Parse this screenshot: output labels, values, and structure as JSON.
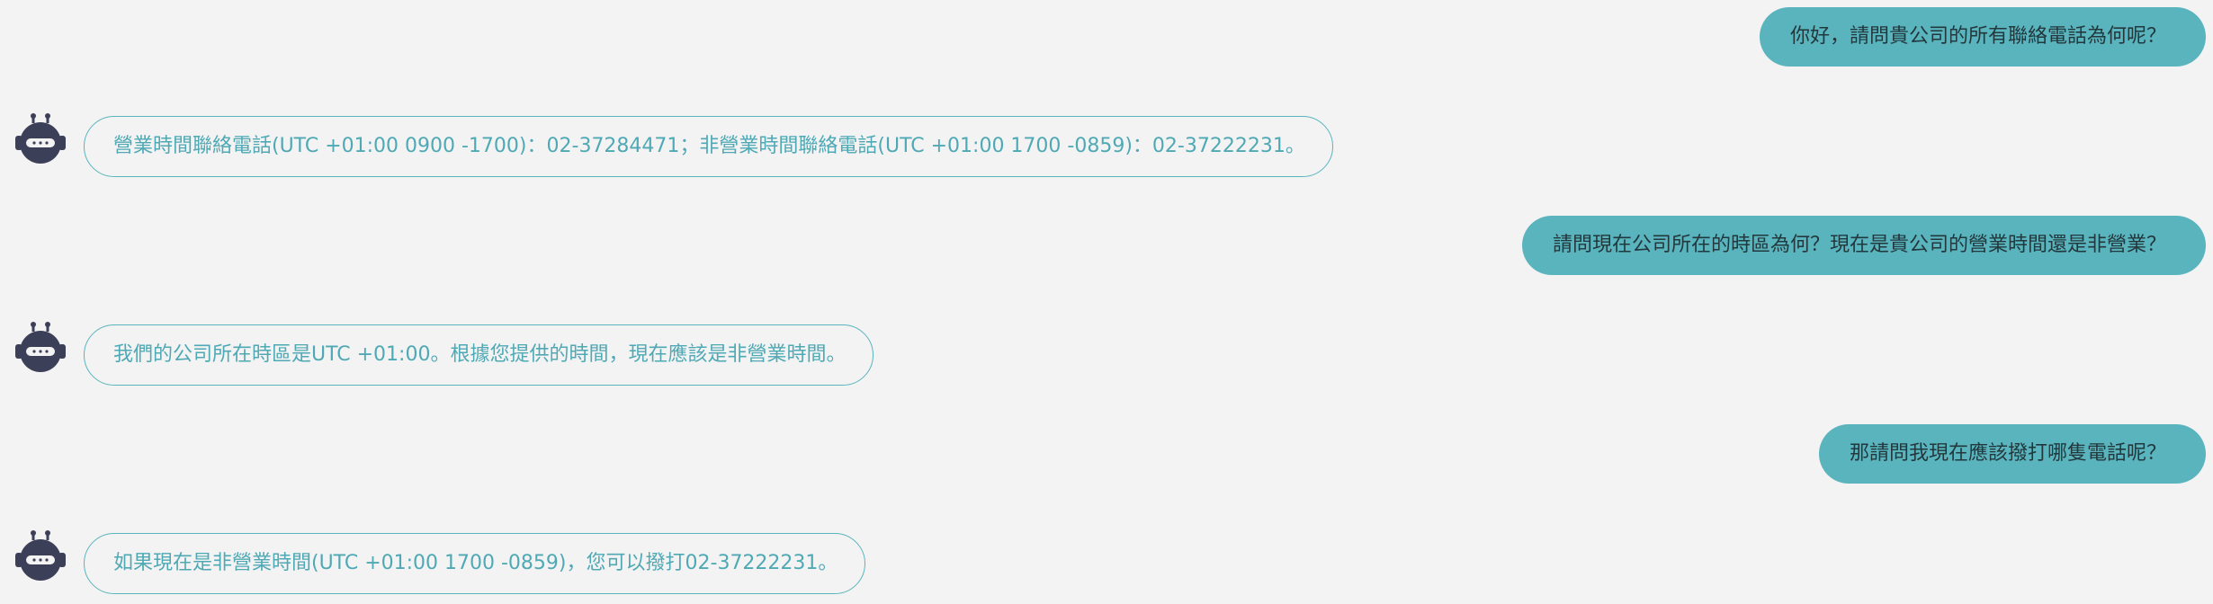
{
  "colors": {
    "page_background": "#f3f3f3",
    "user_bubble": "#5ab4be",
    "user_text": "#23383c",
    "bot_border": "#5ab4be",
    "bot_text": "#4fa9b5",
    "avatar": "#3c3f58"
  },
  "chat": {
    "messages": [
      {
        "role": "user",
        "text": "你好，請問貴公司的所有聯絡電話為何呢？"
      },
      {
        "role": "bot",
        "avatar_icon": "robot-icon",
        "text": "營業時間聯絡電話(UTC +01:00 0900 -1700)：02-37284471；非營業時間聯絡電話(UTC +01:00 1700 -0859)：02-37222231。"
      },
      {
        "role": "user",
        "text": "請問現在公司所在的時區為何？現在是貴公司的營業時間還是非營業？"
      },
      {
        "role": "bot",
        "avatar_icon": "robot-icon",
        "text": "我們的公司所在時區是UTC +01:00。根據您提供的時間，現在應該是非營業時間。"
      },
      {
        "role": "user",
        "text": "那請問我現在應該撥打哪隻電話呢？"
      },
      {
        "role": "bot",
        "avatar_icon": "robot-icon",
        "text": "如果現在是非營業時間(UTC +01:00 1700 -0859)，您可以撥打02-37222231。"
      }
    ]
  }
}
